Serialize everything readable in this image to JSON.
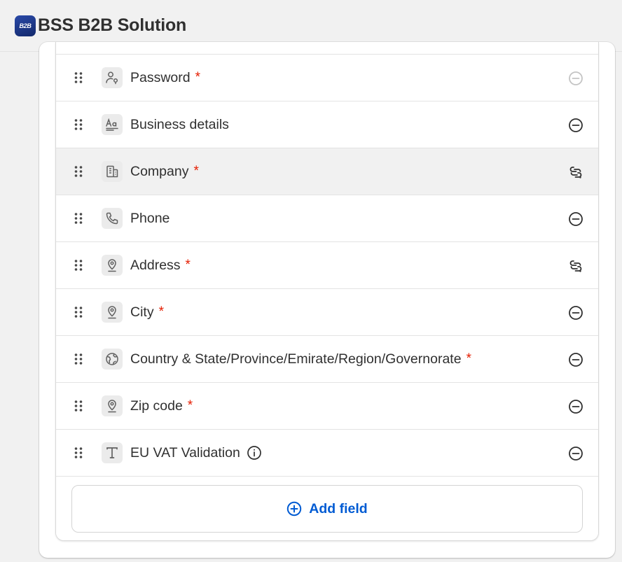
{
  "app": {
    "logo_text": "B2B",
    "title": "BSS B2B Solution"
  },
  "fields": [
    {
      "label": "Password",
      "required": true,
      "icon": "person-lock-icon",
      "action": "remove-disabled"
    },
    {
      "label": "Business details",
      "required": false,
      "icon": "text-font-icon",
      "action": "remove"
    },
    {
      "label": "Company",
      "required": true,
      "icon": "building-icon",
      "action": "connected",
      "highlighted": true
    },
    {
      "label": "Phone",
      "required": false,
      "icon": "phone-icon",
      "action": "remove"
    },
    {
      "label": "Address",
      "required": true,
      "icon": "location-pin-icon",
      "action": "connected"
    },
    {
      "label": "City",
      "required": true,
      "icon": "location-pin-icon",
      "action": "remove"
    },
    {
      "label": "Country & State/Province/Emirate/Region/Governorate",
      "required": true,
      "icon": "globe-icon",
      "action": "remove"
    },
    {
      "label": "Zip code",
      "required": true,
      "icon": "location-pin-icon",
      "action": "remove"
    },
    {
      "label": "EU VAT Validation",
      "required": false,
      "icon": "text-t-icon",
      "action": "remove",
      "info": true
    }
  ],
  "required_marker": "*",
  "add_field_label": "Add field",
  "colors": {
    "required": "#e51c00",
    "link": "#005bd3",
    "highlight_row": "#f1f1f1"
  }
}
